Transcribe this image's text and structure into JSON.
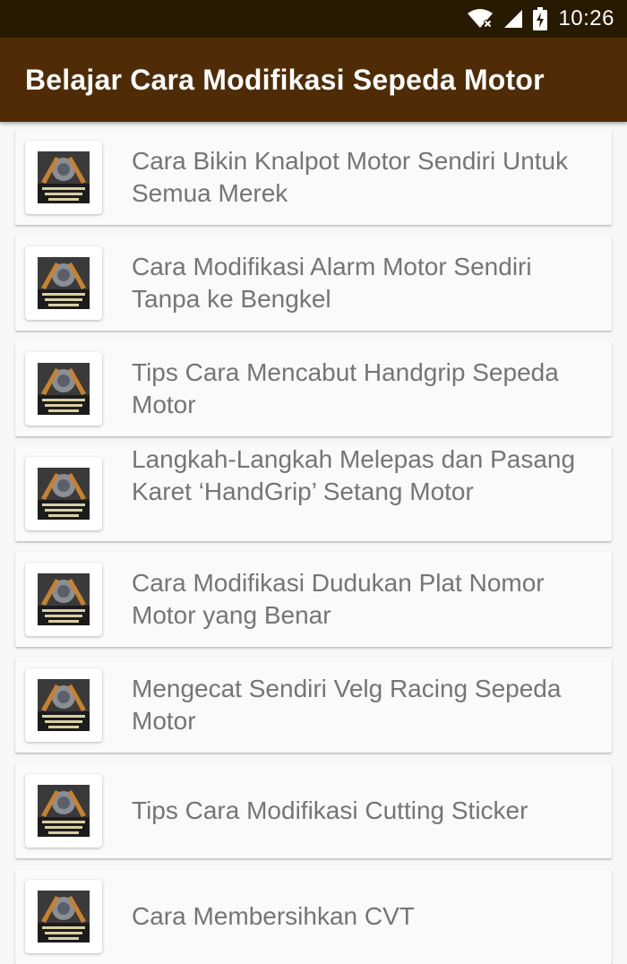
{
  "status_bar": {
    "time": "10:26",
    "icons": [
      "wifi-off-icon",
      "signal-icon",
      "battery-charging-icon"
    ]
  },
  "app_bar": {
    "title": "Belajar Cara Modifikasi Sepeda Motor"
  },
  "items": [
    {
      "title": "Cara Bikin Knalpot Motor Sendiri Untuk Semua Merek",
      "thumb_label": "Belajar Cara Modifikasi Sepeda Motor"
    },
    {
      "title": "Cara Modifikasi Alarm Motor Sendiri Tanpa ke Bengkel",
      "thumb_label": "Belajar Cara Modifikasi Sepeda Motor"
    },
    {
      "title": "Tips Cara Mencabut Handgrip Sepeda Motor",
      "thumb_label": "Belajar Cara Modifikasi Sepeda Motor"
    },
    {
      "title": "Langkah-Langkah Melepas dan Pasang Karet ‘HandGrip’ Setang Motor",
      "thumb_label": "Belajar Cara Modifikasi Sepeda Motor"
    },
    {
      "title": "Cara Modifikasi Dudukan Plat Nomor Motor yang Benar",
      "thumb_label": "Belajar Cara Modifikasi Sepeda Motor"
    },
    {
      "title": "Mengecat Sendiri Velg Racing Sepeda Motor",
      "thumb_label": "Belajar Cara Modifikasi Sepeda Motor"
    },
    {
      "title": "Tips Cara Modifikasi Cutting Sticker",
      "thumb_label": "Belajar Cara Modifikasi Sepeda Motor"
    },
    {
      "title": "Cara Membersihkan CVT",
      "thumb_label": "Belajar Cara Modifikasi Sepeda Motor"
    }
  ],
  "colors": {
    "status_bar": "#281a00",
    "app_bar": "#4f2c06",
    "background": "#f7f7f7",
    "card": "#fafafa",
    "item_text": "#757575"
  }
}
